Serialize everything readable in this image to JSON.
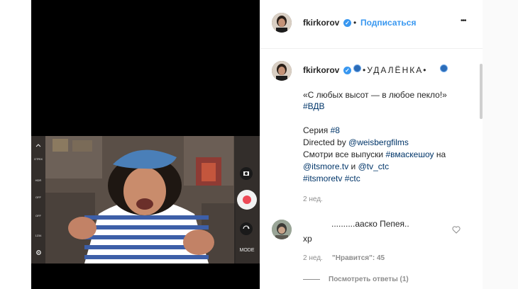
{
  "header": {
    "username": "fkirkorov",
    "separator": "•",
    "follow_label": "Подписаться",
    "more_label": "•••"
  },
  "caption": {
    "username": "fkirkorov",
    "title": "•УДАЛЁНКА•",
    "line1": "«С любых высот — в любое пекло!»",
    "hashtag_vdv": "#ВДВ",
    "series_prefix": "Серия ",
    "series_tag": "#8",
    "directed_prefix": "Directed by ",
    "directed_mention": "@weisbergfilms",
    "watch_prefix": "Смотри все выпуски ",
    "watch_tag": "#вмаскешоу",
    "watch_suffix": " на",
    "mention_itsmore": "@itsmore.tv",
    "and_word": " и ",
    "mention_tvctc": "@tv_ctc",
    "tag_itsmoretv": "#itsmoretv",
    "tag_ctc": "#ctc",
    "time": "2 нед."
  },
  "comment": {
    "partial_text_top": "..........ааско Пепея..",
    "partial_text_bottom": "хр",
    "time": "2 нед.",
    "likes": "\"Нравится\": 45",
    "view_replies": "Посмотреть ответы (1)"
  },
  "camera_ui": {
    "mode_label": "MODE",
    "ctl_labels": [
      "OTRIX",
      "HDR",
      "OFF",
      "OFF",
      "1234"
    ]
  },
  "colors": {
    "link": "#003569",
    "follow": "#3897f0",
    "record": "#ed4956"
  }
}
